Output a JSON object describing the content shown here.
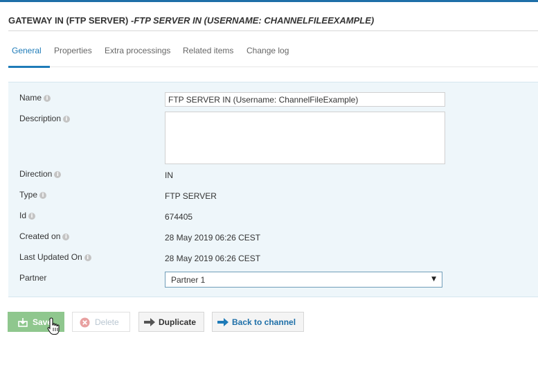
{
  "header": {
    "title_main": "GATEWAY IN (FTP SERVER)",
    "title_sub": " -FTP SERVER IN (USERNAME: CHANNELFILEEXAMPLE)"
  },
  "tabs": [
    {
      "label": "General",
      "active": true
    },
    {
      "label": "Properties",
      "active": false
    },
    {
      "label": "Extra processings",
      "active": false
    },
    {
      "label": "Related items",
      "active": false
    },
    {
      "label": "Change log",
      "active": false
    }
  ],
  "form": {
    "name": {
      "label": "Name",
      "value": "FTP SERVER IN (Username: ChannelFileExample)"
    },
    "description": {
      "label": "Description",
      "value": ""
    },
    "direction": {
      "label": "Direction",
      "value": "IN"
    },
    "type": {
      "label": "Type",
      "value": "FTP SERVER"
    },
    "id": {
      "label": "Id",
      "value": "674405"
    },
    "created_on": {
      "label": "Created on",
      "value": "28 May 2019 06:26 CEST"
    },
    "last_updated_on": {
      "label": "Last Updated On",
      "value": "28 May 2019 06:26 CEST"
    },
    "partner": {
      "label": "Partner",
      "value": "Partner 1"
    }
  },
  "buttons": {
    "save": "Save",
    "delete": "Delete",
    "duplicate": "Duplicate",
    "back": "Back to channel"
  },
  "colors": {
    "accent": "#1e7bb8",
    "panel_bg": "#eef6fa",
    "save_green": "#8fc78e",
    "delete_red": "#e8a0a0"
  },
  "icons": {
    "info": "info-icon",
    "save": "save-icon",
    "delete": "delete-circle-x-icon",
    "duplicate": "arrow-right-icon",
    "back": "arrow-right-icon",
    "select": "chevron-down-icon",
    "cursor": "hand-pointer-icon"
  }
}
